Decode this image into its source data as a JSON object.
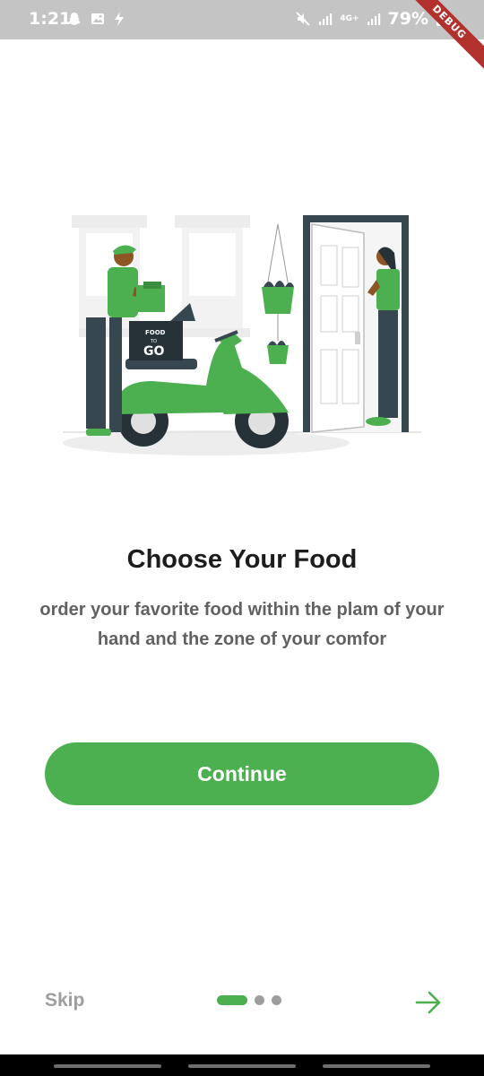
{
  "status_bar": {
    "time": "1:21",
    "battery": "79%",
    "debug_label": "DEBUG",
    "network_label": "4G+",
    "left_icons": [
      "snapchat-icon",
      "image-icon",
      "flash-icon"
    ],
    "right_icons": [
      "mute-icon",
      "signal-icon",
      "signal-icon",
      "battery-icon"
    ]
  },
  "onboarding": {
    "title": "Choose Your Food",
    "subtitle": "order your favorite food within the plam of your hand and the zone of your comfor",
    "continue_label": "Continue",
    "skip_label": "Skip",
    "page_count": 3,
    "active_page": 1,
    "illustration": {
      "box_text_top": "FOOD",
      "box_text_mid": "TO",
      "box_text_bottom": "GO"
    }
  },
  "colors": {
    "accent": "#4caf50",
    "title": "#1c1c1c",
    "subtitle": "#616161",
    "muted": "#9e9e9e",
    "status_bar": "#c4c4c4"
  }
}
